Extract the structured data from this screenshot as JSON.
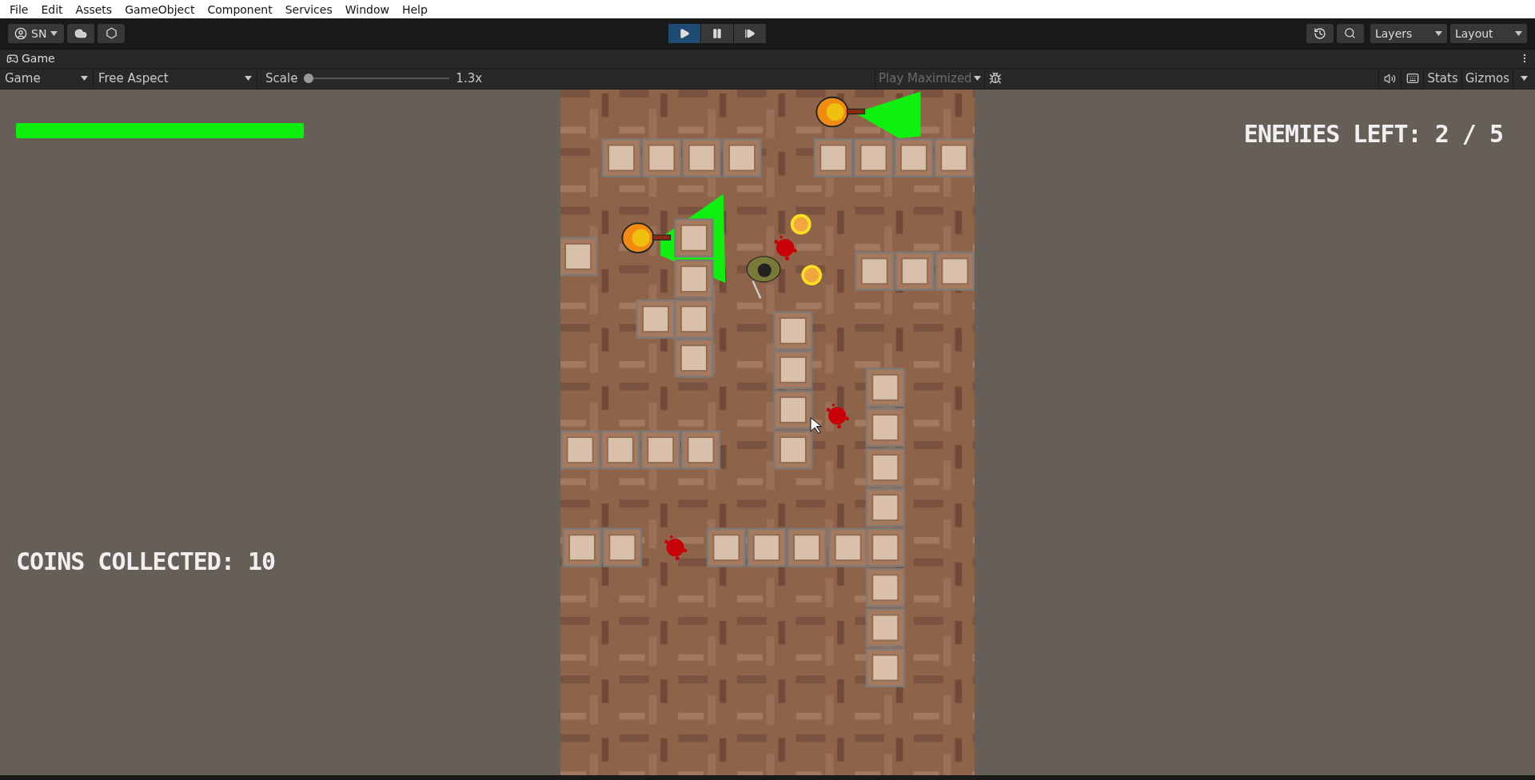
{
  "menu_bar": [
    "File",
    "Edit",
    "Assets",
    "GameObject",
    "Component",
    "Services",
    "Window",
    "Help"
  ],
  "toolbar": {
    "account": "SN",
    "play_controls": [
      {
        "kind": "play",
        "selected": true
      },
      {
        "kind": "pause",
        "selected": false
      },
      {
        "kind": "step",
        "selected": false
      }
    ],
    "layers": "Layers",
    "layout": "Layout"
  },
  "game_tab": {
    "title": "Game"
  },
  "game_toolbar": {
    "display": "Game",
    "aspect": "Free Aspect",
    "scale_label": "Scale",
    "scale": {
      "level": 0,
      "reading": "1.3x"
    },
    "play_mode": {
      "label": "Play Maximized",
      "disabled": true
    },
    "stats": "Stats",
    "gizmos": "Gizmos"
  },
  "hud": {
    "health": {
      "level": 1
    },
    "coins": "COINS COLLECTED: 10",
    "enemies": "ENEMIES LEFT: 2 / 5"
  }
}
